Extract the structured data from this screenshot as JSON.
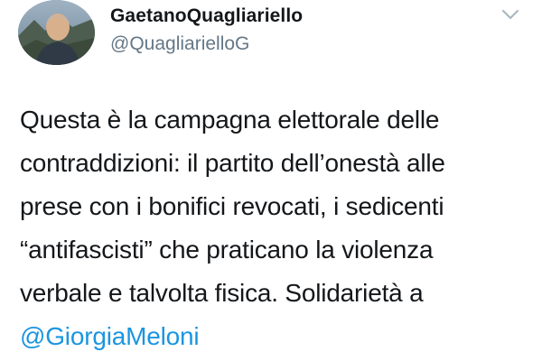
{
  "user": {
    "display_name": "GaetanoQuagliariello",
    "handle": "@QuagliarielloG",
    "avatar_icon": "profile-photo"
  },
  "menu": {
    "icon": "chevron-down-icon",
    "color": "#aab8c2"
  },
  "tweet": {
    "lines": [
      "Questa è la campagna elettorale delle",
      "contraddizioni: il partito dell’onestà alle",
      "prese con i bonifici revocati, i sedicenti",
      "“antifascisti” che praticano la violenza",
      "verbale e talvolta fisica. Solidarietà a"
    ],
    "mention": "@GiorgiaMeloni"
  },
  "colors": {
    "text": "#14171a",
    "secondary": "#657786",
    "link": "#1b95e0"
  }
}
